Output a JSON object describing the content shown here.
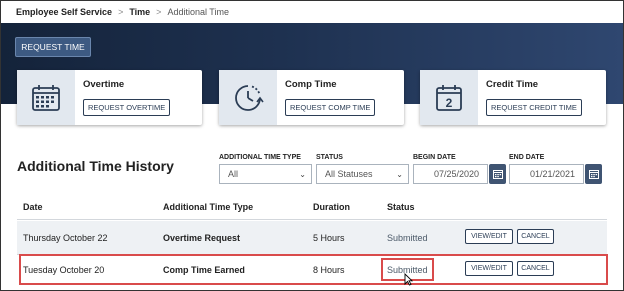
{
  "breadcrumb": {
    "item1": "Employee Self Service",
    "sep": ">",
    "item2": "Time",
    "item3": "Additional Time"
  },
  "hero": {
    "request_time_label": "REQUEST TIME"
  },
  "cards": [
    {
      "title": "Overtime",
      "button": "REQUEST OVERTIME",
      "icon": "calendar-grid-icon"
    },
    {
      "title": "Comp Time",
      "button": "REQUEST COMP TIME",
      "icon": "clock-refresh-icon"
    },
    {
      "title": "Credit Time",
      "button": "REQUEST CREDIT TIME",
      "icon": "calendar-2-icon"
    }
  ],
  "history": {
    "title": "Additional Time History",
    "filters": {
      "type_label": "ADDITIONAL TIME TYPE",
      "type_value": "All",
      "status_label": "STATUS",
      "status_value": "All Statuses",
      "begin_label": "BEGIN DATE",
      "begin_value": "07/25/2020",
      "end_label": "END DATE",
      "end_value": "01/21/2021"
    },
    "columns": [
      "Date",
      "Additional Time Type",
      "Duration",
      "Status"
    ],
    "rows": [
      {
        "date": "Thursday October 22",
        "type": "Overtime Request",
        "duration": "5 Hours",
        "status": "Submitted",
        "view": "VIEW/EDIT",
        "cancel": "CANCEL"
      },
      {
        "date": "Tuesday October 20",
        "type": "Comp Time Earned",
        "duration": "8 Hours",
        "status": "Submitted",
        "view": "VIEW/EDIT",
        "cancel": "CANCEL"
      }
    ]
  },
  "colors": {
    "hero_dark": "#14233a",
    "accent": "#3d5a82",
    "highlight": "#d94b4b"
  }
}
